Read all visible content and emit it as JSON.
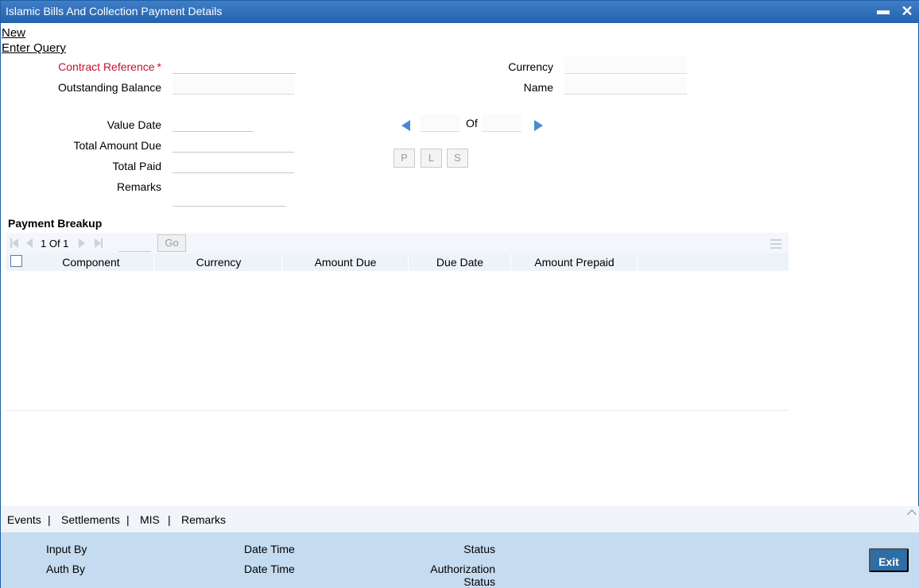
{
  "window": {
    "title": "Islamic Bills And Collection Payment Details",
    "minimize_glyph": "▬",
    "close_glyph": "✕"
  },
  "menu": {
    "new_label": "New",
    "enter_query_label": "Enter Query"
  },
  "form": {
    "contract_reference_label": "Contract Reference",
    "required_marker": "*",
    "outstanding_balance_label": "Outstanding Balance",
    "currency_label": "Currency",
    "name_label": "Name",
    "value_date_label": "Value Date",
    "total_amount_due_label": "Total Amount Due",
    "total_paid_label": "Total Paid",
    "remarks_label": "Remarks",
    "of_label": "Of",
    "contract_reference_value": "",
    "outstanding_balance_value": "",
    "currency_value": "",
    "name_value": "",
    "value_date_value": "",
    "total_amount_due_value": "",
    "total_paid_value": "",
    "remarks_value": "",
    "record_current": "",
    "record_total": ""
  },
  "buttons": {
    "p_label": "P",
    "l_label": "L",
    "s_label": "S"
  },
  "payment_breakup": {
    "title": "Payment Breakup",
    "pager_text": "1 Of 1",
    "page_input": "",
    "go_label": "Go",
    "columns": [
      "Component",
      "Currency",
      "Amount Due",
      "Due Date",
      "Amount Prepaid"
    ],
    "rows": []
  },
  "tabs": {
    "events": "Events",
    "settlements": "Settlements",
    "mis": "MIS",
    "remarks": "Remarks",
    "separator": "|"
  },
  "footer": {
    "input_by": "Input By",
    "auth_by": "Auth By",
    "date_time_1": "Date Time",
    "date_time_2": "Date Time",
    "status": "Status",
    "authorization": "Authorization",
    "authorization_status": "Status",
    "exit_label": "Exit"
  },
  "colors": {
    "title_bar": "#2463ad",
    "required": "#c8102e",
    "footer_bg": "#c5dbef",
    "exit_button": "#2f6ea5"
  }
}
